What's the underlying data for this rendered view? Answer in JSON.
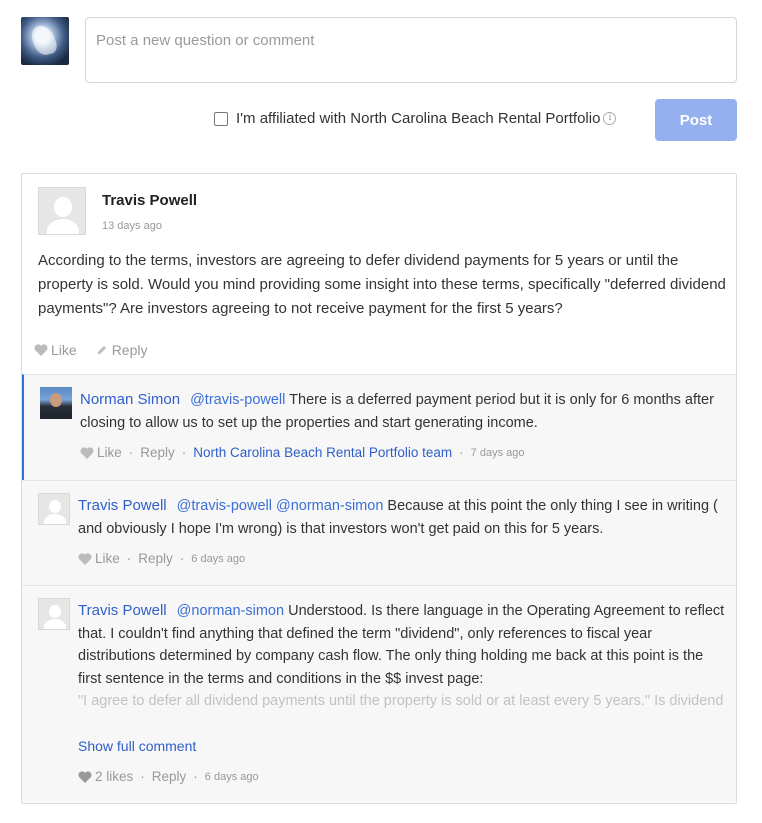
{
  "composer": {
    "placeholder": "Post a new question or comment",
    "affiliation_label": "I'm affiliated with North Carolina Beach Rental Portfolio",
    "post_label": "Post",
    "post_button_color": "#94b0ef"
  },
  "thread": {
    "main": {
      "author": "Travis Powell",
      "time": "13 days ago",
      "text": "According to the terms, investors are agreeing to defer dividend payments for 5 years or until the property is sold. Would you mind providing some insight into these terms, specifically \"deferred dividend payments\"? Are investors agreeing to not receive payment for the first 5 years?",
      "like_label": "Like",
      "reply_label": "Reply"
    },
    "replies": [
      {
        "author": "Norman Simon",
        "mention": "@travis-powell",
        "text": "There is a deferred payment period but it is only for 6 months after closing to allow us to set up the properties and start generating income.",
        "like_label": "Like",
        "reply_label": "Reply",
        "team": "North Carolina Beach Rental Portfolio team",
        "time": "7 days ago"
      },
      {
        "author": "Travis Powell",
        "mention": "@travis-powell @norman-simon",
        "text": "Because at this point the only thing I see in writing ( and obviously I hope I'm wrong) is that investors won't get paid on this for 5 years.",
        "like_label": "Like",
        "reply_label": "Reply",
        "time": "6 days ago"
      },
      {
        "author": "Travis Powell",
        "mention": "@norman-simon",
        "text": "Understood. Is there language in the Operating Agreement to reflect that. I couldn't find anything that defined the term \"dividend\", only references to fiscal year distributions determined by company cash flow. The only thing holding me back at this point is the first sentence in the terms and conditions in the $$ invest page:",
        "quote": "\"I agree to defer all dividend payments until the property is sold or at least every 5 years.\" Is dividend different from annual distributions, and where in the Operating Agreement does it make",
        "show_full": "Show full comment",
        "likes_label": "2 likes",
        "reply_label": "Reply",
        "time": "6 days ago"
      }
    ]
  }
}
